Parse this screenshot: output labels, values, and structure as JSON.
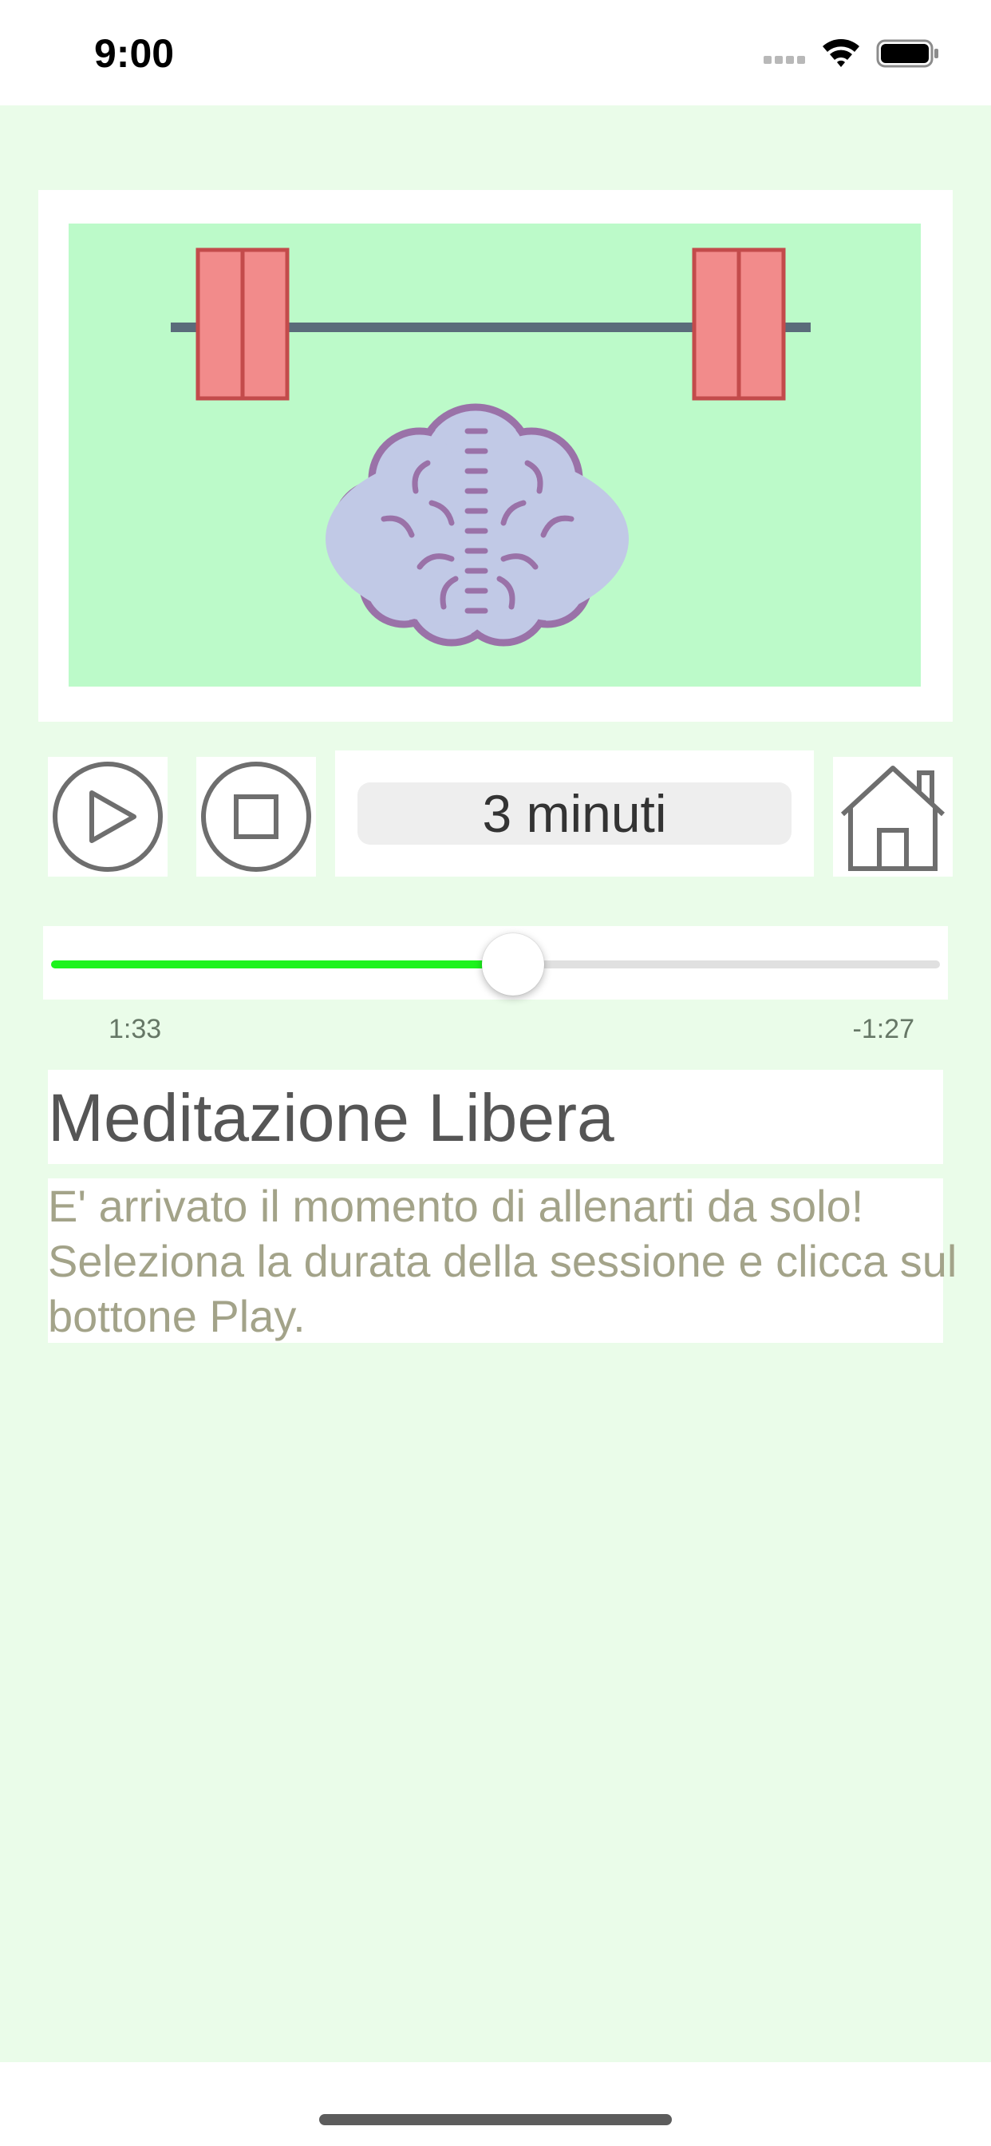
{
  "status_bar": {
    "time": "9:00",
    "icons": [
      "signal-icon",
      "wifi-icon",
      "battery-icon"
    ]
  },
  "hero": {
    "image": "barbell-and-brain-illustration",
    "colors": {
      "background": "#bcfac9",
      "weights": "#f28b8b",
      "bar": "#5a6b7a",
      "brain": "#c1c9e6",
      "brain_outline": "#9a72a8"
    }
  },
  "controls": {
    "play_icon": "play-icon",
    "stop_icon": "stop-icon",
    "duration_value": "3 minuti",
    "home_icon": "home-icon"
  },
  "player": {
    "progress": 0.52,
    "elapsed": "1:33",
    "remaining": "-1:27",
    "fill_color": "#1df31d"
  },
  "session": {
    "title": "Meditazione Libera",
    "description": "E' arrivato il momento di allenarti da solo! Seleziona la durata della sessione e clicca sul bottone Play."
  },
  "theme": {
    "background": "#eafce9"
  }
}
